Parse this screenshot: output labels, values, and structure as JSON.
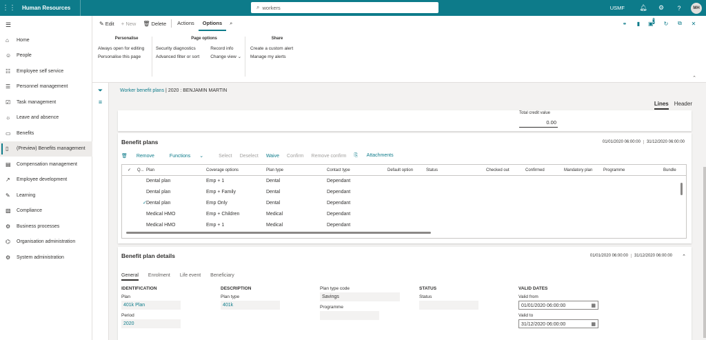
{
  "topbar": {
    "app_title": "Human Resources",
    "search_placeholder": "workers",
    "company": "USMF",
    "user_initials": "MH"
  },
  "nav": {
    "items": [
      {
        "label": "Home",
        "icon": "home-icon"
      },
      {
        "label": "People",
        "icon": "people-icon"
      },
      {
        "label": "Employee self service",
        "icon": "self-service-icon"
      },
      {
        "label": "Personnel management",
        "icon": "personnel-icon"
      },
      {
        "label": "Task management",
        "icon": "task-icon"
      },
      {
        "label": "Leave and absence",
        "icon": "leave-icon"
      },
      {
        "label": "Benefits",
        "icon": "benefits-icon"
      },
      {
        "label": "(Preview) Benefits management",
        "icon": "benefits-mgmt-icon"
      },
      {
        "label": "Compensation management",
        "icon": "compensation-icon"
      },
      {
        "label": "Employee development",
        "icon": "development-icon"
      },
      {
        "label": "Learning",
        "icon": "learning-icon"
      },
      {
        "label": "Compliance",
        "icon": "compliance-icon"
      },
      {
        "label": "Business processes",
        "icon": "process-icon"
      },
      {
        "label": "Organisation administration",
        "icon": "org-icon"
      },
      {
        "label": "System administration",
        "icon": "system-icon"
      }
    ]
  },
  "actionpane": {
    "edit": "Edit",
    "new": "New",
    "delete": "Delete",
    "actions_tab": "Actions",
    "options_tab": "Options",
    "groups": {
      "personalise": {
        "title": "Personalise",
        "items": [
          "Always open for editing",
          "Personalise this page"
        ]
      },
      "page_options": {
        "title": "Page options",
        "col1": [
          "Security diagnostics",
          "Advanced filter or sort"
        ],
        "col2": [
          "Record info",
          "Change view"
        ]
      },
      "share": {
        "title": "Share",
        "items": [
          "Create a custom alert",
          "Manage my alerts"
        ]
      }
    },
    "notification_count": "0"
  },
  "breadcrumb": {
    "link": "Worker benefit plans",
    "separator": "|",
    "current": "2020 : BENJAMIN MARTIN"
  },
  "view_tabs": {
    "lines": "Lines",
    "header": "Header"
  },
  "top_card": {
    "label": "Total credit value",
    "value": "0.00"
  },
  "benefit_plans": {
    "title": "Benefit plans",
    "date_from": "01/01/2020 06:00:00",
    "date_to": "31/12/2020 06:00:00",
    "toolbar": {
      "remove": "Remove",
      "functions": "Functions",
      "select": "Select",
      "deselect": "Deselect",
      "waive": "Waive",
      "confirm": "Confirm",
      "remove_confirm": "Remove confirm",
      "attachments": "Attachments"
    },
    "columns": [
      "Q...",
      "Plan",
      "Coverage options",
      "Plan type",
      "Contact type",
      "Default option",
      "Status",
      "Checked out",
      "Confirmed",
      "Mandatory plan",
      "Programme",
      "Bundle"
    ],
    "rows": [
      {
        "checked": "",
        "plan": "Dental plan",
        "coverage": "Emp + 1",
        "type": "Dental",
        "contact": "Dependant"
      },
      {
        "checked": "",
        "plan": "Dental plan",
        "coverage": "Emp + Family",
        "type": "Dental",
        "contact": "Dependant"
      },
      {
        "checked": "✓",
        "plan": "Dental plan",
        "coverage": "Emp Only",
        "type": "Dental",
        "contact": "Dependant"
      },
      {
        "checked": "",
        "plan": "Medical HMO",
        "coverage": "Emp + Children",
        "type": "Medical",
        "contact": "Dependant"
      },
      {
        "checked": "",
        "plan": "Medical HMO",
        "coverage": "Emp + 1",
        "type": "Medical",
        "contact": "Dependant"
      }
    ]
  },
  "details": {
    "title": "Benefit plan details",
    "date_from": "01/01/2020 06:00:00",
    "date_to": "31/12/2020 06:00:00",
    "tabs": [
      "General",
      "Enrolment",
      "Life event",
      "Beneficiary"
    ],
    "identification": {
      "title": "IDENTIFICATION",
      "plan_label": "Plan",
      "plan_value": "401k Plan",
      "period_label": "Period",
      "period_value": "2020"
    },
    "description": {
      "title": "DESCRIPTION",
      "plan_type_label": "Plan type",
      "plan_type_value": "401k"
    },
    "misc": {
      "plan_type_code_label": "Plan type code",
      "plan_type_code_value": "Savings",
      "programme_label": "Programme"
    },
    "status": {
      "title": "STATUS",
      "status_label": "Status"
    },
    "valid_dates": {
      "title": "VALID DATES",
      "from_label": "Valid from",
      "from_value": "01/01/2020 06:00:00",
      "to_label": "Valid to",
      "to_value": "31/12/2020 06:00:00"
    }
  }
}
